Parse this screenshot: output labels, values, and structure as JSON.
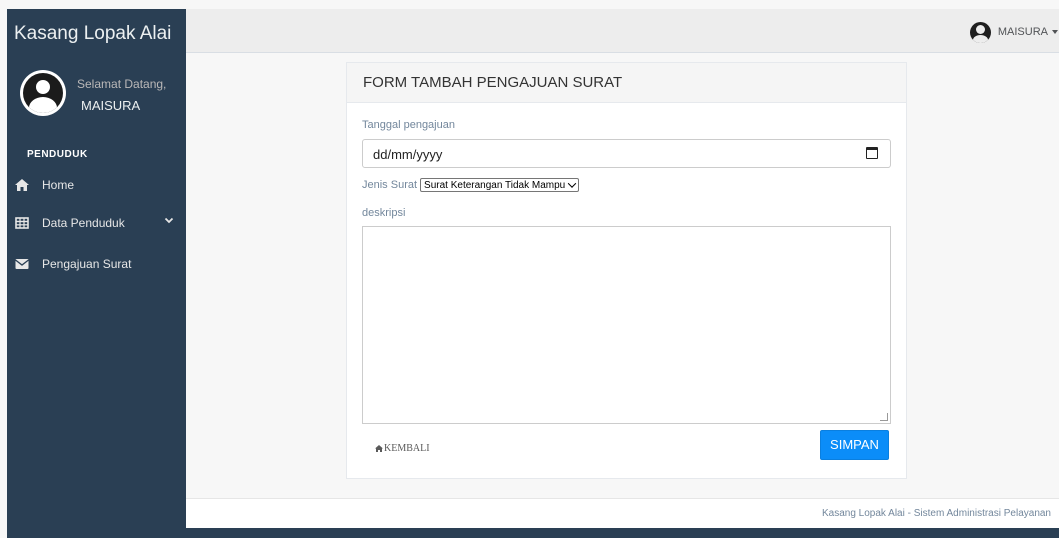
{
  "sidebar": {
    "brand": "Kasang Lopak Alai",
    "welcome": "Selamat Datang,",
    "username": "MAISURA",
    "section_title": "PENDUDUK",
    "items": [
      {
        "label": "Home",
        "icon": "home-icon"
      },
      {
        "label": "Data Penduduk",
        "icon": "table-icon",
        "has_dropdown": true
      },
      {
        "label": "Pengajuan Surat",
        "icon": "envelope-icon"
      }
    ]
  },
  "topnav": {
    "user_label": "MAISURA"
  },
  "form": {
    "title": "FORM TAMBAH PENGAJUAN SURAT",
    "date_label": "Tanggal pengajuan",
    "date_placeholder": "dd/mm/yyyy",
    "jenis_label": "Jenis Surat",
    "jenis_selected": "Surat Keterangan Tidak Mampu",
    "deskripsi_label": "deskripsi",
    "deskripsi_value": "",
    "back_label": "KEMBALI",
    "submit_label": "SIMPAN"
  },
  "footer": {
    "text": "Kasang Lopak Alai - Sistem Administrasi Pelayanan"
  },
  "colors": {
    "sidebar_bg": "#2a3f54",
    "accent_button": "#0b8df8",
    "topnav_bg": "#ededed"
  }
}
